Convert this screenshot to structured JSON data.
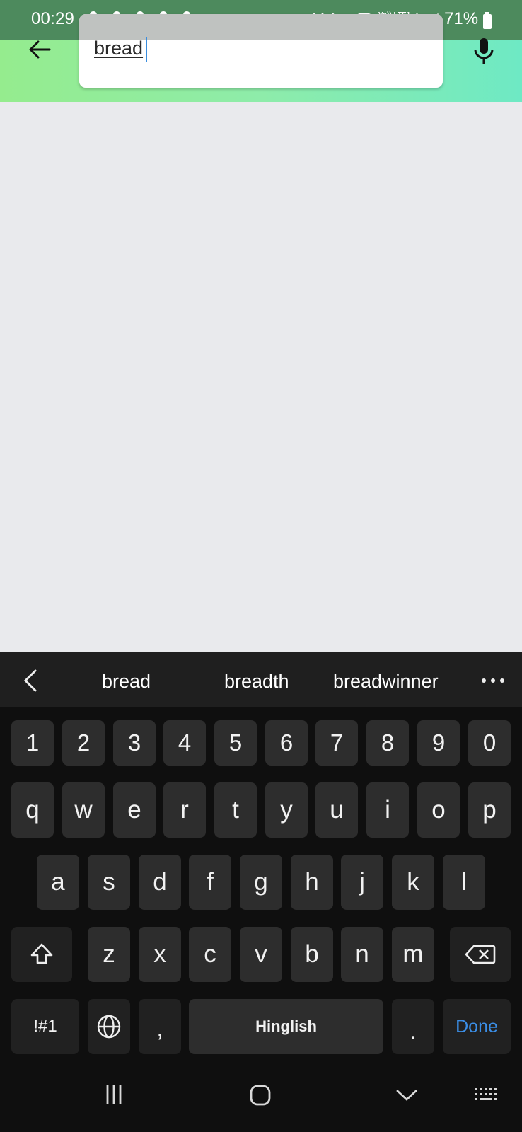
{
  "status_bar": {
    "time": "00:29",
    "battery": "71%",
    "network_label": "Vo)) LTE1",
    "notification_icons": [
      "snapchat-icon",
      "snapchat-icon",
      "snapchat-icon",
      "snapchat-icon",
      "snapchat-icon"
    ],
    "system_icons": [
      "alarm-icon",
      "mute-icon",
      "wifi-icon",
      "signal-icon",
      "signal-icon",
      "battery-icon"
    ]
  },
  "search": {
    "value": "bread"
  },
  "colors": {
    "header_start": "#95ec8e",
    "header_end": "#6ee9c4",
    "keyboard_bg": "#0f0f0f",
    "key_bg": "#2d2d2d",
    "done_accent": "#3b8ee6",
    "caret": "#3a8dde"
  },
  "keyboard": {
    "suggestions": [
      "bread",
      "breadth",
      "breadwinner"
    ],
    "number_row": [
      "1",
      "2",
      "3",
      "4",
      "5",
      "6",
      "7",
      "8",
      "9",
      "0"
    ],
    "row1": [
      "q",
      "w",
      "e",
      "r",
      "t",
      "y",
      "u",
      "i",
      "o",
      "p"
    ],
    "row2": [
      "a",
      "s",
      "d",
      "f",
      "g",
      "h",
      "j",
      "k",
      "l"
    ],
    "row3": [
      "z",
      "x",
      "c",
      "v",
      "b",
      "n",
      "m"
    ],
    "symbols_label": "!#1",
    "comma_label": ",",
    "space_label": "Hinglish",
    "period_label": ".",
    "done_label": "Done"
  }
}
